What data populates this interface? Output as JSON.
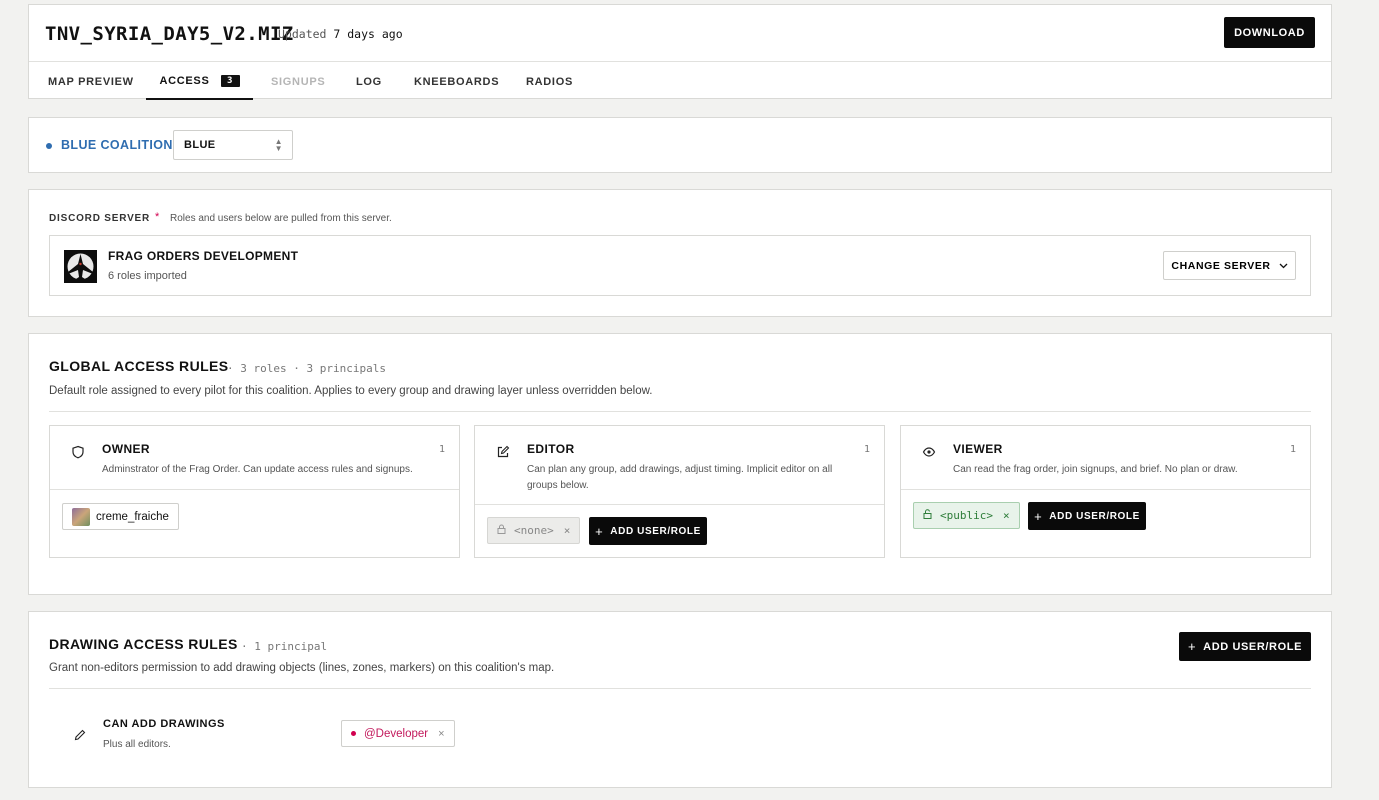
{
  "header": {
    "file_title": "TNV_SYRIA_DAY5_V2.MIZ",
    "updated_prefix": "Updated",
    "updated_value": "7 days ago",
    "download_label": "DOWNLOAD"
  },
  "tabs": [
    {
      "label": "MAP PREVIEW",
      "state": "normal"
    },
    {
      "label": "ACCESS",
      "badge": "3",
      "state": "active"
    },
    {
      "label": "SIGNUPS",
      "state": "disabled"
    },
    {
      "label": "LOG",
      "state": "normal"
    },
    {
      "label": "KNEEBOARDS",
      "state": "normal"
    },
    {
      "label": "RADIOS",
      "state": "normal"
    }
  ],
  "coalition": {
    "label": "BLUE COALITION",
    "selected": "BLUE",
    "color": "#2f6db0"
  },
  "discord": {
    "label": "DISCORD SERVER",
    "required_marker": "*",
    "note": "Roles and users below are pulled from this server.",
    "server_name": "FRAG ORDERS DEVELOPMENT",
    "server_sub": "6 roles imported",
    "change_label": "CHANGE SERVER"
  },
  "global_rules": {
    "title": "GLOBAL ACCESS RULES",
    "meta": "· 3 roles · 3 principals",
    "description": "Default role assigned to every pilot for this coalition. Applies to every group and drawing layer unless overridden below.",
    "roles": [
      {
        "name": "OWNER",
        "count": "1",
        "icon": "shield-icon",
        "description": "Adminstrator of the Frag Order. Can update access rules and signups.",
        "principals": [
          {
            "label": "creme_fraiche",
            "kind": "user"
          }
        ]
      },
      {
        "name": "EDITOR",
        "count": "1",
        "icon": "pencil-square-icon",
        "description": "Can plan any group, add drawings, adjust timing. Implicit editor on all groups below.",
        "principals": [
          {
            "label": "<none>",
            "kind": "none",
            "remove": "×"
          }
        ],
        "add_label": "ADD USER/ROLE"
      },
      {
        "name": "VIEWER",
        "count": "1",
        "icon": "eye-icon",
        "description": "Can read the frag order, join signups, and brief. No plan or draw.",
        "principals": [
          {
            "label": "<public>",
            "kind": "public",
            "remove": "×"
          }
        ],
        "add_label": "ADD USER/ROLE"
      }
    ]
  },
  "drawing_rules": {
    "title": "DRAWING ACCESS RULES",
    "meta": "· 1 principal",
    "description": "Grant non-editors permission to add drawing objects (lines, zones, markers) on this coalition's map.",
    "add_label": "ADD USER/ROLE",
    "rule_name": "CAN ADD DRAWINGS",
    "rule_sub": "Plus all editors.",
    "principal": {
      "label": "@Developer",
      "kind": "role",
      "color": "#d1004f",
      "remove": "×"
    }
  }
}
